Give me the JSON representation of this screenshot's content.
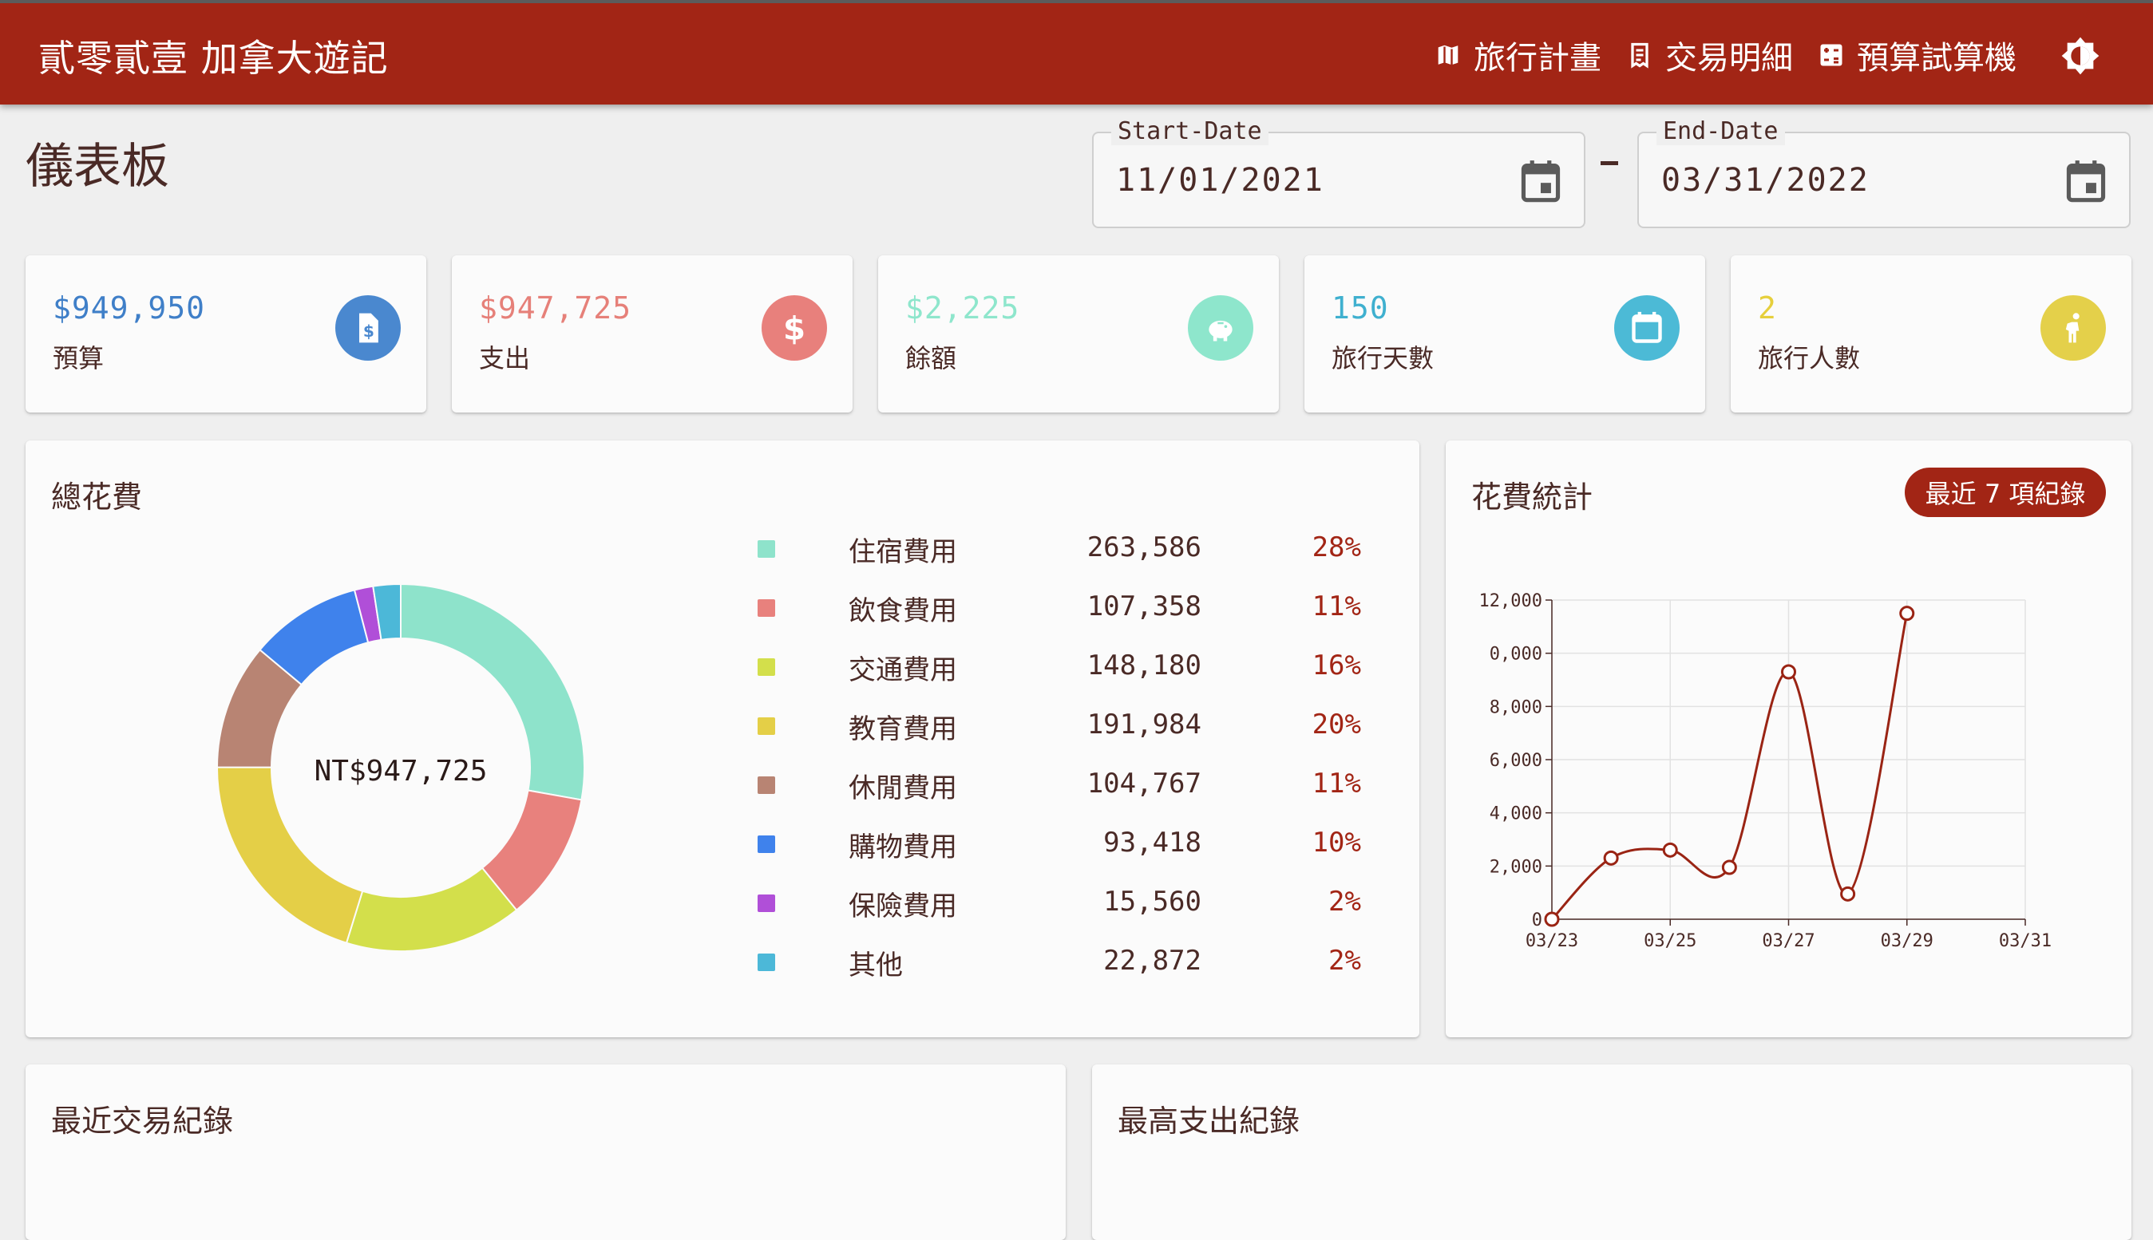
{
  "app": {
    "title": "貳零貳壹 加拿大遊記",
    "nav": [
      {
        "label": "旅行計畫",
        "icon": "map-icon"
      },
      {
        "label": "交易明細",
        "icon": "receipt-icon"
      },
      {
        "label": "預算試算機",
        "icon": "calculator-icon"
      }
    ],
    "theme_icon": "brightness-icon"
  },
  "page": {
    "title": "儀表板"
  },
  "dates": {
    "start_label": "Start-Date",
    "start_value": "11/01/2021",
    "end_label": "End-Date",
    "end_value": "03/31/2022",
    "separator": "-"
  },
  "stats": [
    {
      "value": "$949,950",
      "label": "預算",
      "color": "#3f7fc8",
      "icon_bg": "#4a88cf",
      "icon": "document-dollar-icon"
    },
    {
      "value": "$947,725",
      "label": "支出",
      "color": "#e68079",
      "icon_bg": "#e8807c",
      "icon": "dollar-icon"
    },
    {
      "value": "$2,225",
      "label": "餘額",
      "color": "#8ee6cc",
      "icon_bg": "#8ee6cc",
      "icon": "piggy-bank-icon"
    },
    {
      "value": "150",
      "label": "旅行天數",
      "color": "#3fb0cf",
      "icon_bg": "#4cbad6",
      "icon": "calendar-icon"
    },
    {
      "value": "2",
      "label": "旅行人數",
      "color": "#e6cf3c",
      "icon_bg": "#e4d04a",
      "icon": "walking-person-icon"
    }
  ],
  "total_expense": {
    "title": "總花費",
    "center_label": "NT$947,725",
    "categories": [
      {
        "name": "住宿費用",
        "value": "263,586",
        "pct": "28%",
        "amount": 263586,
        "color": "#8ee3cb"
      },
      {
        "name": "飲食費用",
        "value": "107,358",
        "pct": "11%",
        "amount": 107358,
        "color": "#e8817d"
      },
      {
        "name": "交通費用",
        "value": "148,180",
        "pct": "16%",
        "amount": 148180,
        "color": "#d3df4b"
      },
      {
        "name": "教育費用",
        "value": "191,984",
        "pct": "20%",
        "amount": 191984,
        "color": "#e4cf47"
      },
      {
        "name": "休閒費用",
        "value": "104,767",
        "pct": "11%",
        "amount": 104767,
        "color": "#b88473"
      },
      {
        "name": "購物費用",
        "value": "93,418",
        "pct": "10%",
        "amount": 93418,
        "color": "#3f82ec"
      },
      {
        "name": "保險費用",
        "value": "15,560",
        "pct": "2%",
        "amount": 15560,
        "color": "#b04fd8"
      },
      {
        "name": "其他",
        "value": "22,872",
        "pct": "2%",
        "amount": 22872,
        "color": "#4cb8d8"
      }
    ]
  },
  "spending_stats": {
    "title": "花費統計",
    "badge": "最近 7 項紀錄",
    "line_color": "#9a2414"
  },
  "chart_data": {
    "type": "line",
    "x": [
      "03/23",
      "03/24",
      "03/25",
      "03/26",
      "03/27",
      "03/28",
      "03/29",
      "03/30",
      "03/31"
    ],
    "xticks": [
      "03/23",
      "03/25",
      "03/27",
      "03/29",
      "03/31"
    ],
    "points": [
      {
        "x": "03/23",
        "y": 0
      },
      {
        "x": "03/24",
        "y": 2300
      },
      {
        "x": "03/25",
        "y": 2600
      },
      {
        "x": "03/26",
        "y": 1950
      },
      {
        "x": "03/27",
        "y": 9300
      },
      {
        "x": "03/28",
        "y": 950
      },
      {
        "x": "03/29",
        "y": 11500
      }
    ],
    "yticks": [
      "0",
      "2,000",
      "4,000",
      "6,000",
      "8,000",
      "0,000",
      "12,000"
    ],
    "ylim": [
      0,
      12000
    ],
    "grid": true
  },
  "recent": {
    "title": "最近交易紀錄"
  },
  "top": {
    "title": "最高支出紀錄"
  }
}
